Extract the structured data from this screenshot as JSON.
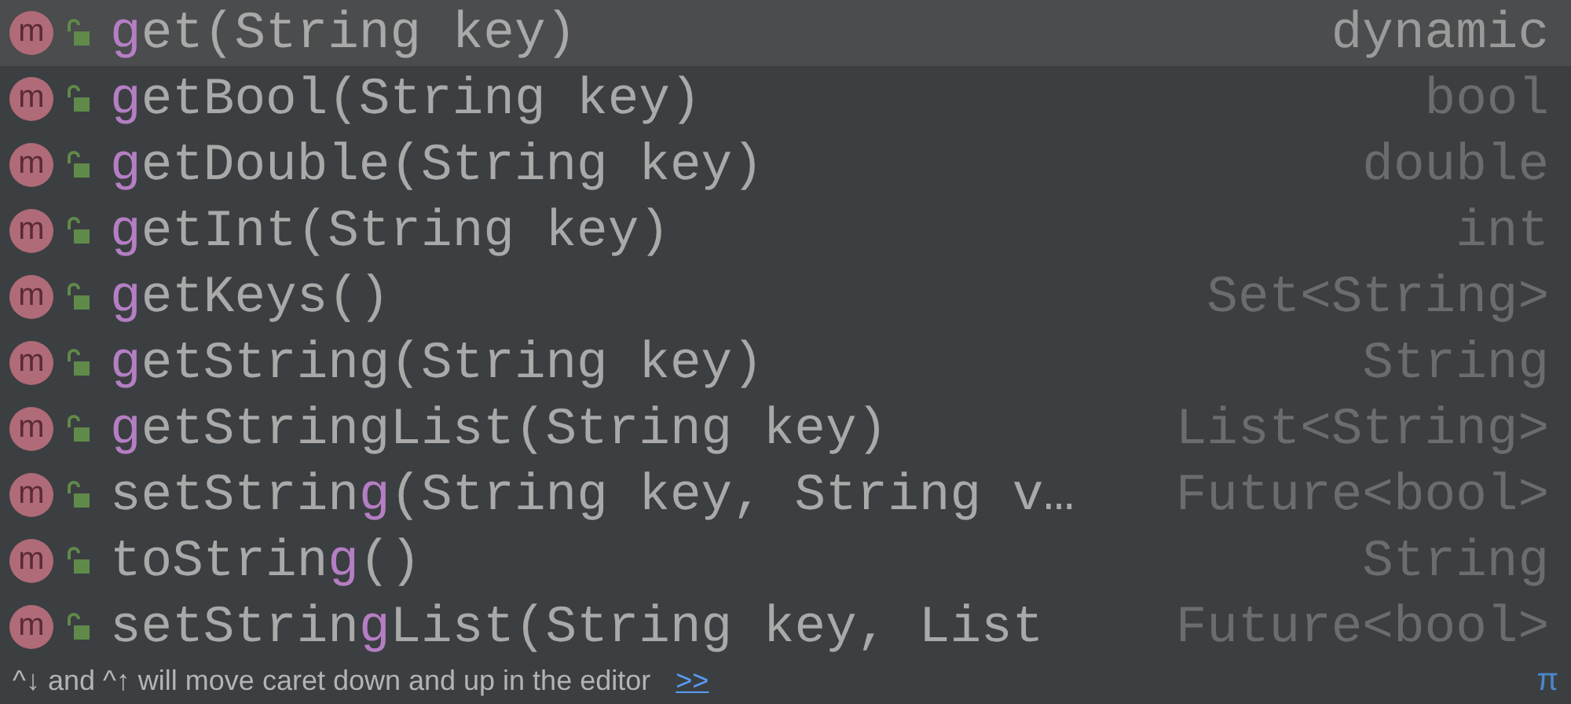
{
  "items": [
    {
      "badge": "m",
      "match": "g",
      "after": "et(String key)",
      "type": "dynamic",
      "selected": true
    },
    {
      "badge": "m",
      "match": "g",
      "after": "etBool(String key)",
      "type": "bool",
      "selected": false
    },
    {
      "badge": "m",
      "match": "g",
      "after": "etDouble(String key)",
      "type": "double",
      "selected": false
    },
    {
      "badge": "m",
      "match": "g",
      "after": "etInt(String key)",
      "type": "int",
      "selected": false
    },
    {
      "badge": "m",
      "match": "g",
      "after": "etKeys()",
      "type": "Set<String>",
      "selected": false
    },
    {
      "badge": "m",
      "match": "g",
      "after": "etString(String key)",
      "type": "String",
      "selected": false
    },
    {
      "badge": "m",
      "match": "g",
      "after": "etStringList(String key)",
      "type": "List<String>",
      "selected": false
    },
    {
      "badge": "m",
      "before": "setStrin",
      "match": "g",
      "after": "(String key, String v…",
      "type": "Future<bool>",
      "selected": false
    },
    {
      "badge": "m",
      "before": "toStrin",
      "match": "g",
      "after": "()",
      "type": "String",
      "selected": false
    },
    {
      "badge": "m",
      "before": "setStrin",
      "match": "g",
      "after": "List(String key, List",
      "type": "Future<bool>",
      "selected": false
    }
  ],
  "footer": {
    "hint": "^↓ and ^↑ will move caret down and up in the editor",
    "link": ">>",
    "corner": "π"
  }
}
